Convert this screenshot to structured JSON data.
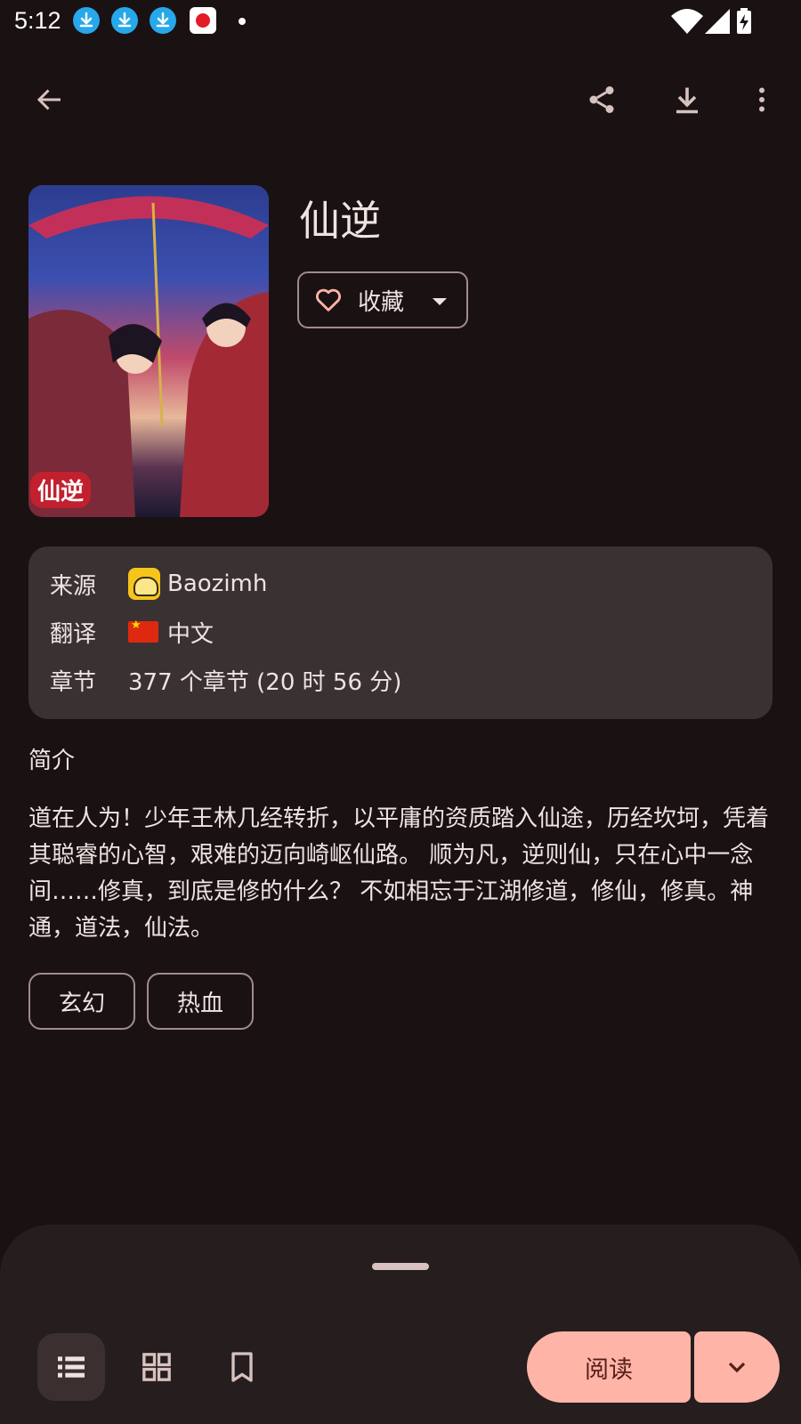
{
  "status_bar": {
    "time": "5:12"
  },
  "toolbar": {
    "back_icon": "arrow-back-icon",
    "share_icon": "share-icon",
    "download_icon": "download-icon",
    "more_icon": "more-vert-icon"
  },
  "manga": {
    "title": "仙逆",
    "cover_logo_text": "仙逆",
    "favorite_label": "收藏"
  },
  "info": {
    "source_label": "来源",
    "source_value": "Baozimh",
    "translation_label": "翻译",
    "translation_value": "中文",
    "chapters_label": "章节",
    "chapters_value": "377 个章节 (20 时 56 分)"
  },
  "synopsis": {
    "title": "简介",
    "text": "道在人为！少年王林几经转折，以平庸的资质踏入仙途，历经坎坷，凭着其聪睿的心智，艰难的迈向崎岖仙路。 顺为凡，逆则仙，只在心中一念间……修真，到底是修的什么？ 不如相忘于江湖修道，修仙，修真。神通，道法，仙法。"
  },
  "tags": [
    "玄幻",
    "热血"
  ],
  "bottom_bar": {
    "read_label": "阅读"
  },
  "colors": {
    "background": "#1a1112",
    "surface_card": "#3a3132",
    "accent": "#ffb4a8",
    "notification_blue": "#26a8ea"
  }
}
